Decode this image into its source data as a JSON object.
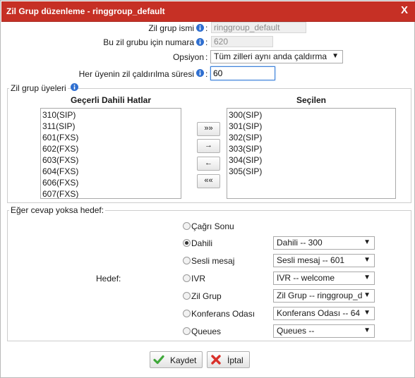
{
  "window": {
    "title": "Zil Grup düzenleme - ringgroup_default",
    "close_label": "X"
  },
  "form": {
    "group_name_label": "Zil grup ismi",
    "group_name_value": "ringgroup_default",
    "group_number_label": "Bu zil grubu için numara",
    "group_number_value": "620",
    "option_label": "Opsiyon",
    "option_value": "Tüm zilleri aynı anda çaldırma",
    "ring_time_label": "Her üyenin zil çaldırılma süresi",
    "ring_time_value": "60",
    "colon": ":"
  },
  "members": {
    "legend": "Zil grup üyeleri",
    "available_header": "Geçerli Dahili Hatlar",
    "selected_header": "Seçilen",
    "available": [
      "310(SIP)",
      "311(SIP)",
      "601(FXS)",
      "602(FXS)",
      "603(FXS)",
      "604(FXS)",
      "606(FXS)",
      "607(FXS)"
    ],
    "selected": [
      "300(SIP)",
      "301(SIP)",
      "302(SIP)",
      "303(SIP)",
      "304(SIP)",
      "305(SIP)"
    ],
    "buttons": {
      "add_all": "»»",
      "add_one": "→",
      "remove_one": "←",
      "remove_all": "««"
    }
  },
  "failover": {
    "legend": "Eğer cevap yoksa hedef:",
    "destination_label": "Hedef:",
    "options": [
      {
        "label": "Çağrı Sonu",
        "selected": false,
        "select_value": ""
      },
      {
        "label": "Dahili",
        "selected": true,
        "select_value": "Dahili -- 300"
      },
      {
        "label": "Sesli mesaj",
        "selected": false,
        "select_value": "Sesli mesaj -- 601"
      },
      {
        "label": "IVR",
        "selected": false,
        "select_value": "IVR -- welcome"
      },
      {
        "label": "Zil Grup",
        "selected": false,
        "select_value": "Zil Grup -- ringgroup_d"
      },
      {
        "label": "Konferans Odası",
        "selected": false,
        "select_value": "Konferans Odası -- 64"
      },
      {
        "label": "Queues",
        "selected": false,
        "select_value": "Queues --"
      }
    ]
  },
  "actions": {
    "save_label": "Kaydet",
    "cancel_label": "İptal"
  },
  "colors": {
    "titlebar": "#c63025",
    "info_icon": "#2f6fd0",
    "save_icon": "#3fa83a",
    "cancel_icon": "#d9302a"
  }
}
